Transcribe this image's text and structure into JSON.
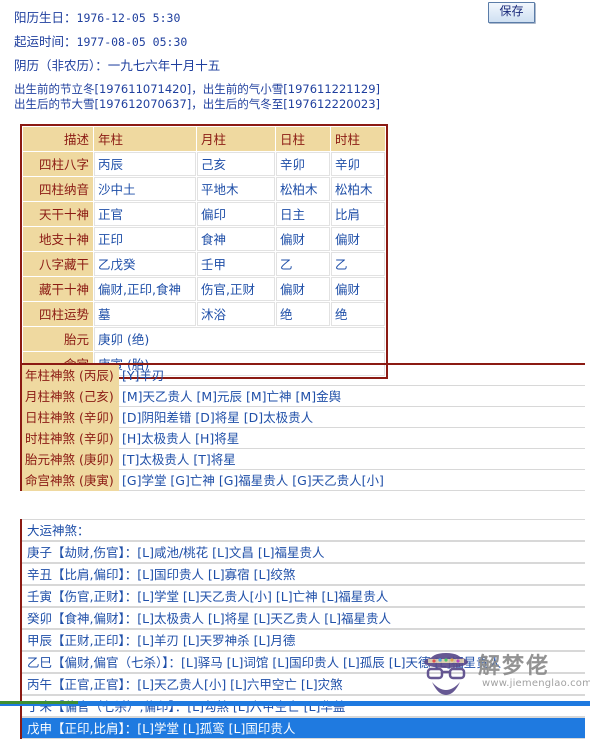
{
  "header": {
    "solar_label": "阳历生日：",
    "solar_value": "1976-12-05 5:30",
    "start_label": "起运时间：",
    "start_value": "1977-08-05 05:30",
    "lunar_label": "阴历（非农历）：",
    "lunar_value": "一九七六年十月十五",
    "jieqi_line1": "出生前的节立冬[197611071420]，出生前的气小雪[197611221129]",
    "jieqi_line2": "出生后的节大雪[197612070637]，出生后的气冬至[197612220023]",
    "save_label": "保存"
  },
  "pillar_table": {
    "headers": [
      "描述",
      "年柱",
      "月柱",
      "日柱",
      "时柱"
    ],
    "rows": [
      {
        "label": "四柱八字",
        "cells": [
          "丙辰",
          "己亥",
          "辛卯",
          "辛卯"
        ]
      },
      {
        "label": "四柱纳音",
        "cells": [
          "沙中土",
          "平地木",
          "松柏木",
          "松柏木"
        ]
      },
      {
        "label": "天干十神",
        "cells": [
          "正官",
          "偏印",
          "日主",
          "比肩"
        ]
      },
      {
        "label": "地支十神",
        "cells": [
          "正印",
          "食神",
          "偏财",
          "偏财"
        ]
      },
      {
        "label": "八字藏干",
        "cells": [
          "乙戊癸",
          "壬甲",
          "乙",
          "乙"
        ]
      },
      {
        "label": "藏干十神",
        "cells": [
          "偏财,正印,食神",
          "伤官,正财",
          "偏财",
          "偏财"
        ]
      },
      {
        "label": "四柱运势",
        "cells": [
          "墓",
          "沐浴",
          "绝",
          "绝"
        ]
      }
    ],
    "span_rows": [
      {
        "label": "胎元",
        "value": "庚卯 (绝)"
      },
      {
        "label": "命宫",
        "value": "庚寅 (胎)"
      }
    ]
  },
  "shensha_table": {
    "rows": [
      {
        "key": "年柱神煞 (丙辰)",
        "value": "[Y]羊刃"
      },
      {
        "key": "月柱神煞 (己亥)",
        "value": "[M]天乙贵人  [M]元辰  [M]亡神  [M]金舆"
      },
      {
        "key": "日柱神煞 (辛卯)",
        "value": "[D]阴阳差错  [D]将星  [D]太极贵人"
      },
      {
        "key": "时柱神煞 (辛卯)",
        "value": "[H]太极贵人  [H]将星"
      },
      {
        "key": "胎元神煞 (庚卯)",
        "value": "[T]太极贵人  [T]将星"
      },
      {
        "key": "命宫神煞 (庚寅)",
        "value": "[G]学堂  [G]亡神  [G]福星贵人  [G]天乙贵人[小]"
      }
    ]
  },
  "dayun_table": {
    "title": "大运神煞：",
    "rows": [
      {
        "gz": "庚子【劫财,伤官】：",
        "value": "[L]咸池/桃花  [L]文昌  [L]福星贵人",
        "selected": false
      },
      {
        "gz": "辛丑【比肩,偏印】：",
        "value": "[L]国印贵人  [L]寡宿  [L]绞煞",
        "selected": false
      },
      {
        "gz": "壬寅【伤官,正财】：",
        "value": "[L]学堂  [L]天乙贵人[小]  [L]亡神  [L]福星贵人",
        "selected": false
      },
      {
        "gz": "癸卯【食神,偏财】：",
        "value": "[L]太极贵人  [L]将星  [L]天乙贵人  [L]福星贵人",
        "selected": false
      },
      {
        "gz": "甲辰【正财,正印】：",
        "value": "[L]羊刃  [L]天罗神杀  [L]月德",
        "selected": false
      },
      {
        "gz": "乙巳【偏财,偏官（七杀）】：",
        "value": "[L]驿马  [L]词馆  [L]国印贵人  [L]孤辰  [L]天德  [L]福星贵人",
        "selected": false
      },
      {
        "gz": "丙午【正官,正官】：",
        "value": "[L]天乙贵人[小]  [L]六甲空亡  [L]灾煞",
        "selected": false
      },
      {
        "gz": "丁未【偏官（七杀）,偏印】：",
        "value": "[L]勾煞  [L]六甲空亡  [L]华盖",
        "selected": false
      },
      {
        "gz": "戊申【正印,比肩】：",
        "value": "[L]学堂  [L]孤鸾  [L]国印贵人",
        "selected": true
      }
    ]
  },
  "watermark": {
    "brand": "解梦佬",
    "url": "www.jiemenglao.com"
  },
  "colors": {
    "border": "#8b1a13",
    "header_bg": "#efd9a0",
    "text": "#1f4fa8",
    "select": "#1f7ae0"
  }
}
